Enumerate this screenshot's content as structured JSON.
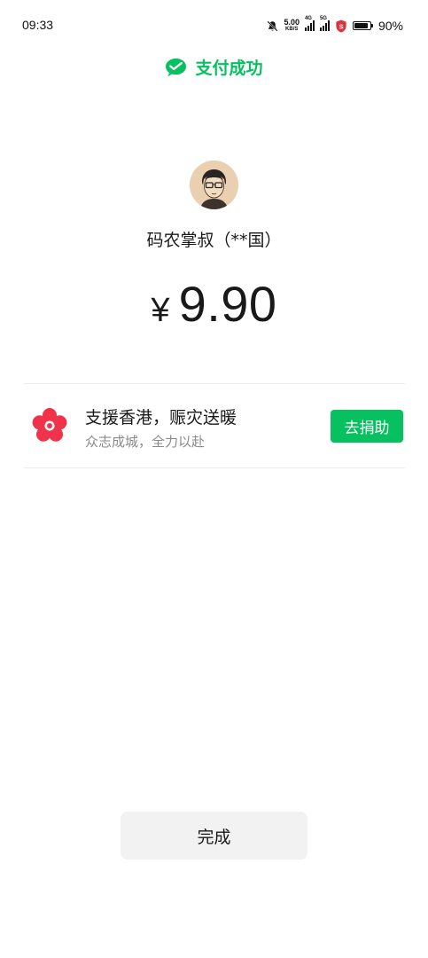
{
  "status_bar": {
    "time": "09:33",
    "net_speed": "5.00",
    "net_speed_unit": "KB/S",
    "signal1_tag": "4G",
    "signal2_tag": "5G",
    "battery_percent": "90%",
    "battery_level": 0.9,
    "icons": [
      "mute-bell-icon",
      "signal-icon",
      "signal-icon",
      "security-shield-icon",
      "battery-icon"
    ]
  },
  "header": {
    "title": "支付成功",
    "icon": "wechat-pay-icon",
    "accent_color": "#07c160"
  },
  "payee": {
    "name": "码农掌叔（**国）",
    "avatar": "avatar"
  },
  "amount": {
    "currency": "¥",
    "value": "9.90"
  },
  "promo": {
    "icon": "flower-icon",
    "icon_color": "#f0334a",
    "title": "支援香港，赈灾送暖",
    "subtitle": "众志成城，全力以赴",
    "button_label": "去捐助"
  },
  "footer": {
    "done_label": "完成"
  }
}
